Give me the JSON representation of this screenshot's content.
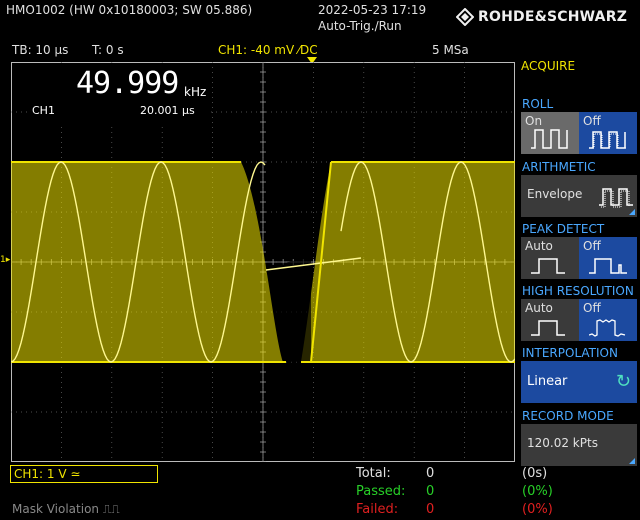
{
  "header": {
    "device_id": "HMO1002 (HW 0x10180003; SW 05.886)",
    "datetime": "2022-05-23 17:19",
    "trigger_mode": "Auto-Trig./Run",
    "brand": "ROHDE&SCHWARZ"
  },
  "status": {
    "timebase": "TB: 10 µs",
    "time_offset": "T: 0 s",
    "channel_info": "CH1: -40 mV ⁄DC",
    "sample_rate": "5 MSa"
  },
  "measurement": {
    "frequency": "49.999",
    "frequency_unit": "kHz",
    "channel": "CH1",
    "period": "20.001 µs"
  },
  "waveform": {
    "channel_marker": "1",
    "trace_color": "#f0e400"
  },
  "bottom": {
    "ch1_scale": "CH1: 1 V ≃",
    "mask_violation": "Mask Violation ⎍⎍",
    "total_label": "Total:",
    "passed_label": "Passed:",
    "failed_label": "Failed:",
    "total_value": "0",
    "passed_value": "0",
    "failed_value": "0",
    "total_pct": "(0s)",
    "passed_pct": "(0%)",
    "failed_pct": "(0%)"
  },
  "menu": {
    "title": "ACQUIRE",
    "roll": {
      "label": "ROLL",
      "on": "On",
      "off": "Off"
    },
    "arithmetic": {
      "label": "ARITHMETIC",
      "value": "Envelope"
    },
    "peak_detect": {
      "label": "PEAK DETECT",
      "auto": "Auto",
      "off": "Off"
    },
    "high_resolution": {
      "label": "HIGH RESOLUTION",
      "auto": "Auto",
      "off": "Off"
    },
    "interpolation": {
      "label": "INTERPOLATION",
      "value": "Linear"
    },
    "record_mode": {
      "label": "RECORD MODE",
      "value": "120.02 kPts"
    }
  }
}
